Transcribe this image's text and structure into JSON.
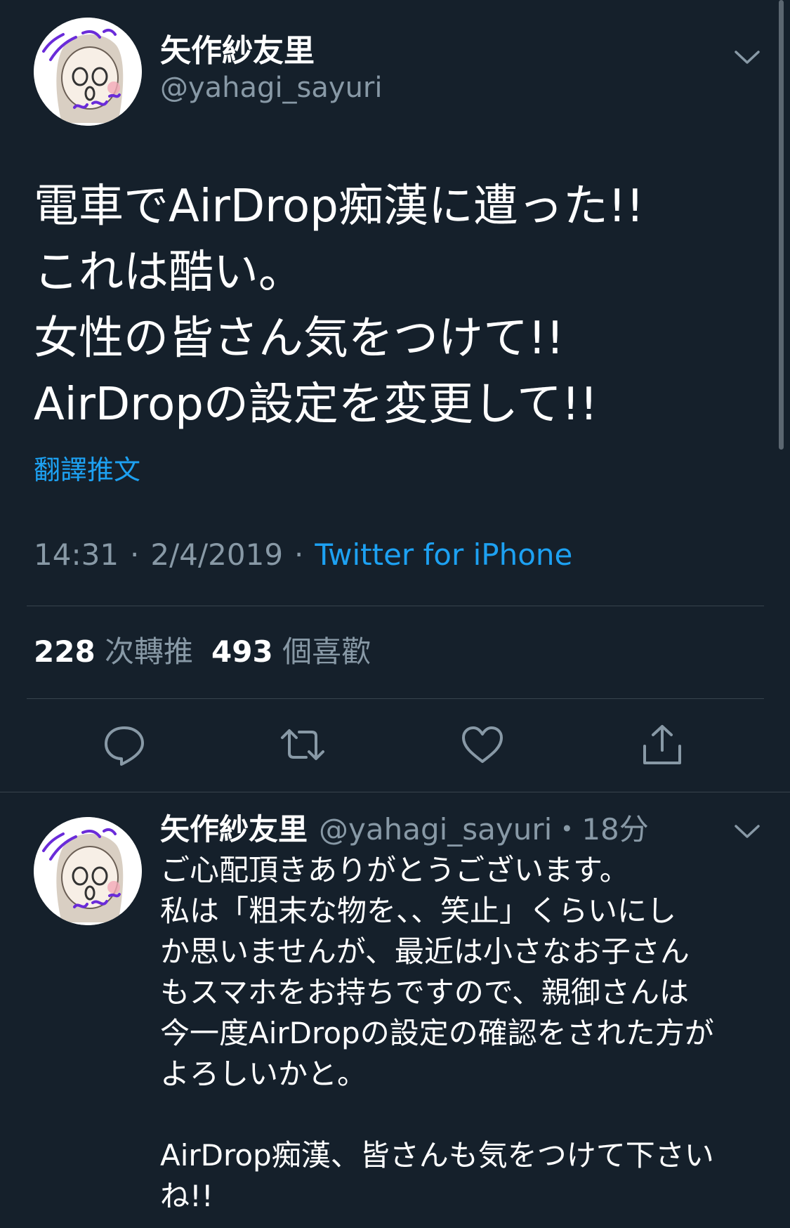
{
  "tweet": {
    "author_name": "矢作紗友里",
    "author_handle": "@yahagi_sayuri",
    "text_lines": [
      "電車でAirDrop痴漢に遭った!!",
      "これは酷い。",
      "女性の皆さん気をつけて!!",
      "AirDropの設定を変更して!!"
    ],
    "translate_label": "翻譯推文",
    "time": "14:31",
    "date": "2/4/2019",
    "separator": "·",
    "source": "Twitter for iPhone",
    "retweet_count": "228",
    "retweet_label": "次轉推",
    "like_count": "493",
    "like_label": "個喜歡"
  },
  "actions": [
    {
      "icon": "reply-icon"
    },
    {
      "icon": "retweet-icon"
    },
    {
      "icon": "like-icon"
    },
    {
      "icon": "share-icon"
    }
  ],
  "reply": {
    "author_name": "矢作紗友里",
    "author_handle": "@yahagi_sayuri",
    "time": "・18分",
    "text_lines": [
      "ご心配頂きありがとうございます。",
      "私は「粗末な物を、、笑止」くらいにし",
      "か思いませんが、最近は小さなお子さん",
      "もスマホをお持ちですので、親御さんは",
      "今一度AirDropの設定の確認をされた方が",
      "よろしいかと。",
      "",
      "AirDrop痴漢、皆さんも気をつけて下さい",
      "ね!!"
    ]
  },
  "colors": {
    "background": "#15202b",
    "text_primary": "#ffffff",
    "text_secondary": "#8899a6",
    "accent": "#1da1f2",
    "divider": "#38444d"
  }
}
